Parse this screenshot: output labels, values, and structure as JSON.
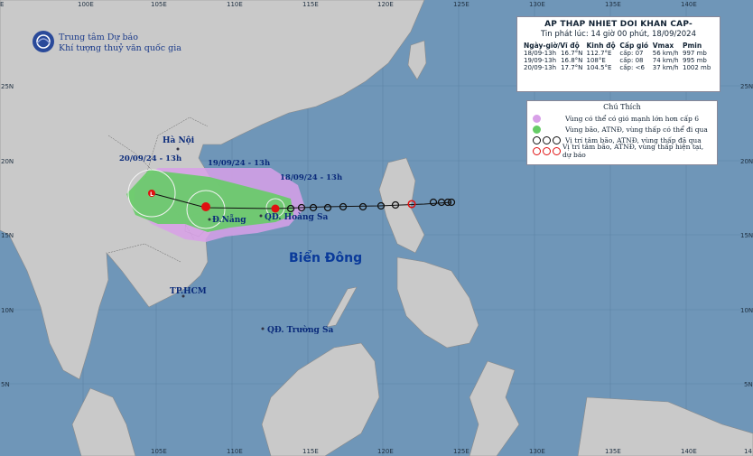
{
  "header": {
    "title": "AP THAP NHIET DOI KHAN CAP-",
    "issued": "Tin phát lúc: 14 giờ 00 phút, 18/09/2024"
  },
  "table": {
    "headers": [
      "Ngày-giờ/Vĩ độ",
      "Kinh độ",
      "Cấp gió",
      "Vmax",
      "Pmin"
    ],
    "rows": [
      {
        "time": "18/09-13h",
        "lat": "16.7°N",
        "lon": "112.7°E",
        "level": "cấp: 07",
        "vmax": "56 km/h",
        "pmin": "997 mb"
      },
      {
        "time": "19/09-13h",
        "lat": "16.8°N",
        "lon": "108°E",
        "level": "cấp: 08",
        "vmax": "74 km/h",
        "pmin": "995 mb"
      },
      {
        "time": "20/09-13h",
        "lat": "17.7°N",
        "lon": "104.5°E",
        "level": "cấp: <6",
        "vmax": "37 km/h",
        "pmin": "1002 mb"
      }
    ]
  },
  "legend": {
    "title": "Chú Thích",
    "items": [
      {
        "text": "Vùng có thể có gió mạnh lớn hơn cấp 6",
        "color": "#d8a0e8"
      },
      {
        "text": "Vùng bão, ATNĐ, vùng thấp có thể đi qua",
        "color": "#88dd88"
      },
      {
        "text": "Vị trí tâm bão, ATNĐ, vùng thấp đã qua",
        "color": "#111111"
      },
      {
        "text": "Vị trí tâm bão, ATNĐ, vùng thấp hiện tại, dự báo",
        "color": "#e01010"
      }
    ]
  },
  "org": {
    "line1": "Trung tâm Dự báo",
    "line2": "Khí tượng thuỷ văn quốc gia"
  },
  "places": {
    "hanoi": "Hà Nội",
    "danang": "Đ.Nẵng",
    "hoangsa": "QĐ. Hoàng Sa",
    "hcm": "TP.HCM",
    "truongsa": "QĐ. Trường Sa",
    "sea": "Biển Đông"
  },
  "track_labels": {
    "t1": "20/09/24 - 13h",
    "t2": "19/09/24 - 13h",
    "t3": "18/09/24 - 13h"
  },
  "axes": {
    "top_lon": [
      "E",
      "100E",
      "105E",
      "110E",
      "115E",
      "120E",
      "125E",
      "130E",
      "135E",
      "140E"
    ],
    "bottom_lon": [
      "105E",
      "110E",
      "115E",
      "120E",
      "125E",
      "130E",
      "135E",
      "140E",
      "14"
    ],
    "left_lat": [
      "25N",
      "20N",
      "15N",
      "10N",
      "5N"
    ],
    "right_lat": [
      "25N",
      "20N",
      "15N",
      "10N",
      "5N"
    ]
  },
  "colors": {
    "ocean": "#6f96b8",
    "land": "#c9c9c9",
    "wind_zone": "#d8a0e8",
    "track_zone": "#66cc66",
    "track_past": "#111111",
    "track_current": "#e01010"
  }
}
